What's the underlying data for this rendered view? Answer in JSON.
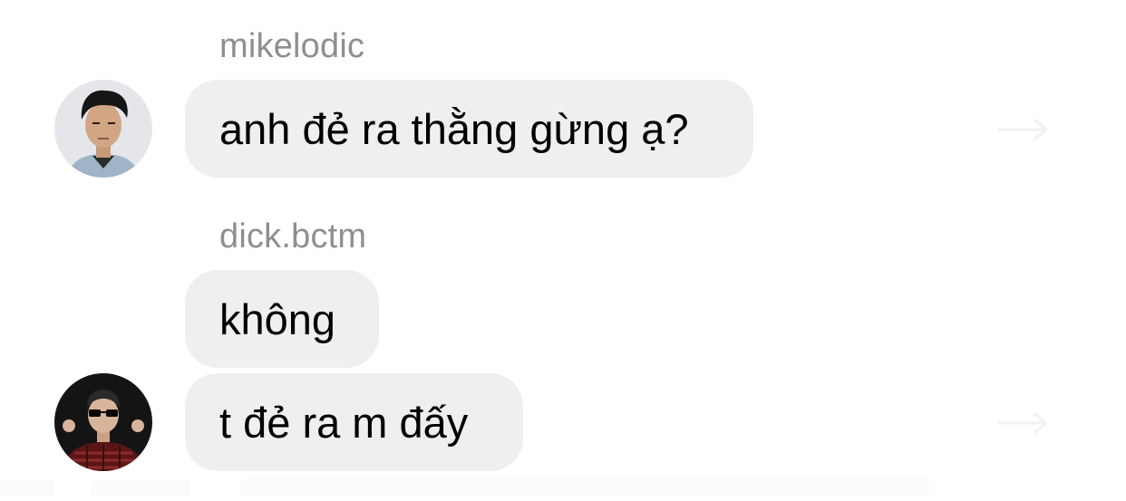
{
  "thread": {
    "messages": [
      {
        "sender": "mikelodic",
        "text": "anh đẻ ra thằng gừng ạ?",
        "avatar_icon": "user-avatar-icon"
      },
      {
        "sender": "dick.bctm",
        "texts": [
          "không",
          "t đẻ ra m đấy"
        ],
        "avatar_icon": "user-avatar-icon"
      }
    ]
  },
  "colors": {
    "bubble_background": "#efefef",
    "username_gray": "#8e8e93",
    "background": "#ffffff"
  },
  "icons": {
    "share": "forward-arrow-icon"
  }
}
